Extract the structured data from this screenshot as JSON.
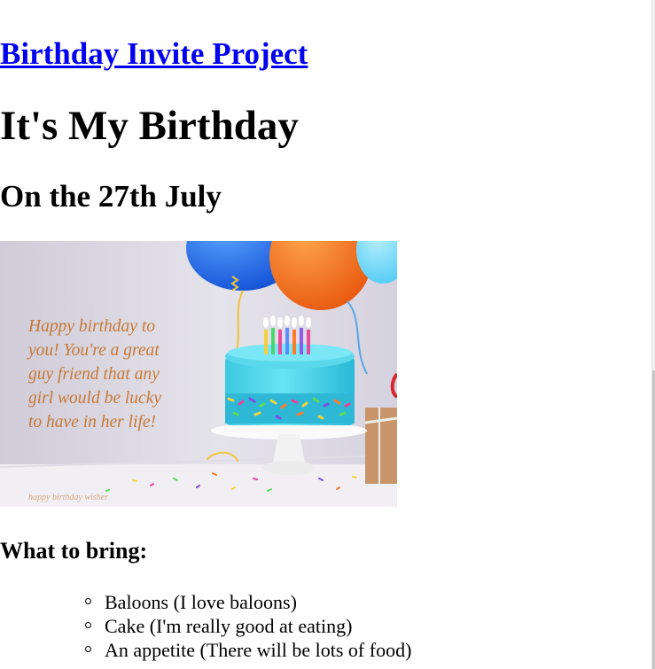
{
  "header": {
    "project_link": "Birthday Invite Project",
    "title": "It's My Birthday",
    "date": "On the 27th July"
  },
  "image": {
    "alt": "Birthday cake with balloons",
    "message_lines": [
      "Happy birthday to",
      "you! You're a great",
      "guy friend that any",
      "girl would be lucky",
      "to have in her life!"
    ],
    "watermark": "happy birthday wisher",
    "colors": {
      "background": "#ddd9e6",
      "cake": "#46d2e8",
      "message_text": "#c87833"
    }
  },
  "bring": {
    "heading": "What to bring:",
    "items": [
      "Baloons (I love baloons)",
      "Cake (I'm really good at eating)",
      "An appetite (There will be lots of food)"
    ]
  },
  "colors": {
    "link": "#0000ee",
    "text": "#000000"
  }
}
